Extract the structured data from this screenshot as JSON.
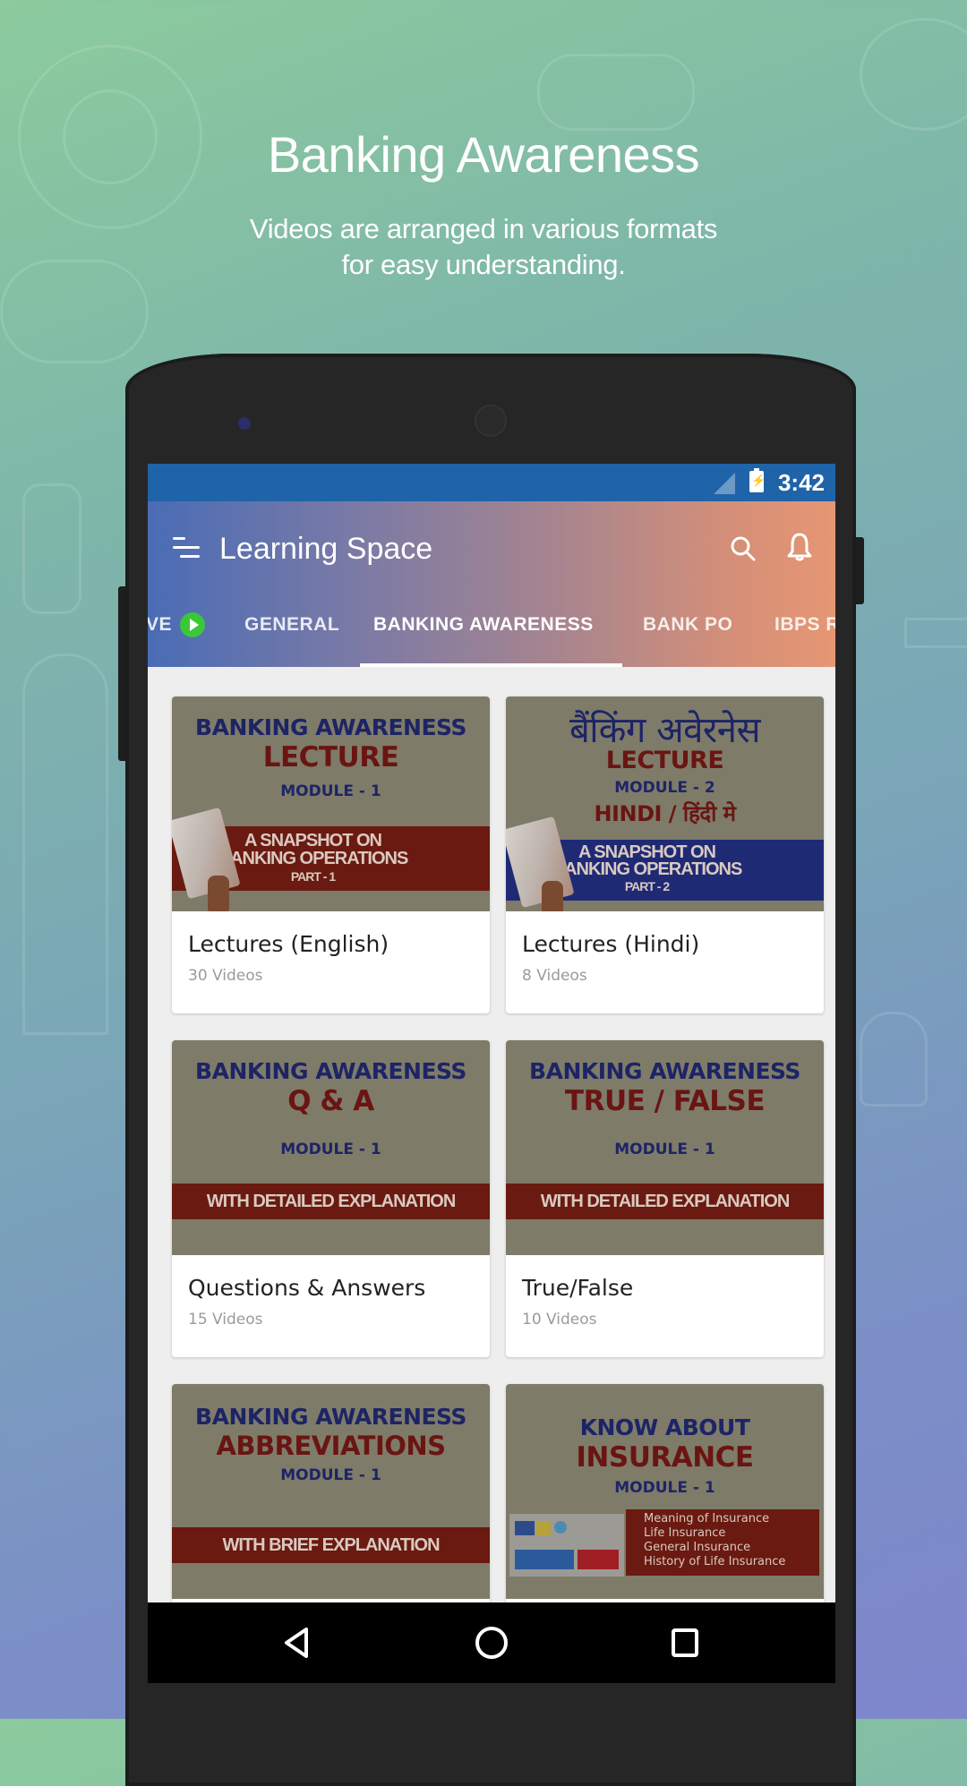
{
  "promo": {
    "title": "Banking Awareness",
    "subtitle_line1": "Videos are arranged in various formats",
    "subtitle_line2": "for easy understanding."
  },
  "status_bar": {
    "time": "3:42"
  },
  "app_bar": {
    "title": "Learning Space",
    "icons": [
      "menu-icon",
      "search-icon",
      "bell-icon"
    ]
  },
  "tabs": {
    "items": [
      {
        "label": "VE",
        "badge": "play-icon",
        "active": false
      },
      {
        "label": "GENERAL",
        "active": false
      },
      {
        "label": "BANKING AWARENESS",
        "active": true
      },
      {
        "label": "BANK PO",
        "active": false
      },
      {
        "label": "IBPS R",
        "active": false
      }
    ]
  },
  "colors": {
    "status_bar": "#1f63a8",
    "appbar_start": "#4a6cb5",
    "appbar_end": "#e69773",
    "live_badge": "#3cc63a",
    "thumb_bg": "#7e7b69",
    "thumb_navy": "#1d2466",
    "thumb_maroon": "#6a1512"
  },
  "cards": [
    {
      "title": "Lectures (English)",
      "count": "30 Videos",
      "thumb": {
        "heading": "BANKING AWARENESS",
        "main": "LECTURE",
        "module": "MODULE - 1",
        "band": "A SNAPSHOT ON",
        "band2": "BANKING OPERATIONS",
        "band3": "PART - 1"
      }
    },
    {
      "title": "Lectures (Hindi)",
      "count": "8 Videos",
      "thumb": {
        "heading": "बैंकिंग अवेरनेस",
        "main": "LECTURE",
        "module": "MODULE - 2",
        "lang": "HINDI / हिंदी मे",
        "band": "A SNAPSHOT ON",
        "band2": "BANKING OPERATIONS",
        "band3": "PART - 2"
      }
    },
    {
      "title": "Questions & Answers",
      "count": "15 Videos",
      "thumb": {
        "heading": "BANKING AWARENESS",
        "main": "Q & A",
        "module": "MODULE - 1",
        "band": "WITH DETAILED EXPLANATION"
      }
    },
    {
      "title": "True/False",
      "count": "10 Videos",
      "thumb": {
        "heading": "BANKING AWARENESS",
        "main": "TRUE / FALSE",
        "module": "MODULE - 1",
        "band": "WITH DETAILED EXPLANATION"
      }
    },
    {
      "title": "",
      "count": "",
      "thumb": {
        "heading": "BANKING AWARENESS",
        "main": "ABBREVIATIONS",
        "module": "MODULE - 1",
        "band": "WITH BRIEF EXPLANATION"
      }
    },
    {
      "title": "",
      "count": "",
      "thumb": {
        "heading": "KNOW ABOUT",
        "main": "INSURANCE",
        "module": "MODULE - 1",
        "bullets": [
          "Meaning of Insurance",
          "Life Insurance",
          "General Insurance",
          "History of Life Insurance"
        ]
      }
    }
  ],
  "nav_bar": {
    "buttons": [
      "back-icon",
      "home-icon",
      "recents-icon"
    ]
  }
}
